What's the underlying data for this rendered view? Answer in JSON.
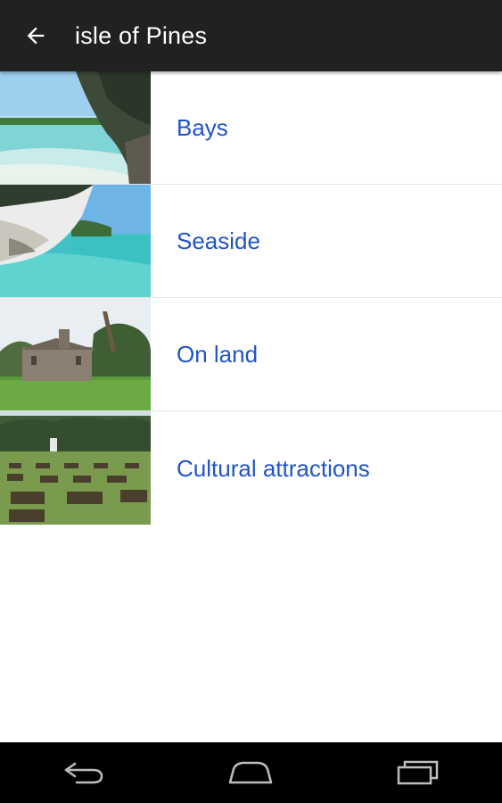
{
  "appbar": {
    "title": "isle of Pines",
    "back_icon": "arrow-back-icon"
  },
  "categories": [
    {
      "label": "Bays",
      "image": "bay-photo"
    },
    {
      "label": "Seaside",
      "image": "seaside-cliff-photo"
    },
    {
      "label": "On land",
      "image": "stone-ruin-photo"
    },
    {
      "label": "Cultural attractions",
      "image": "cemetery-field-photo"
    }
  ],
  "navbar": {
    "back_icon": "nav-back-icon",
    "home_icon": "nav-home-icon",
    "recents_icon": "nav-recents-icon"
  },
  "colors": {
    "appbar_bg": "#212121",
    "link_text": "#1f55c7",
    "navbar_bg": "#000000"
  }
}
